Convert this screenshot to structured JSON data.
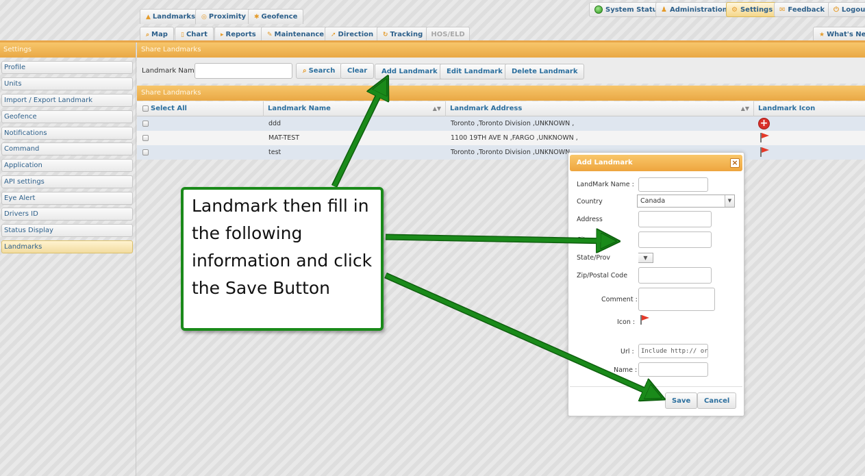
{
  "nav": {
    "row1": [
      {
        "label": "Landmarks"
      },
      {
        "label": "Proximity"
      },
      {
        "label": "Geofence"
      }
    ],
    "row2": [
      {
        "label": "Map"
      },
      {
        "label": "Chart"
      },
      {
        "label": "Reports"
      },
      {
        "label": "Maintenance"
      },
      {
        "label": "Direction"
      },
      {
        "label": "Tracking"
      },
      {
        "label": "HOS/ELD"
      }
    ],
    "right": [
      {
        "label": "System Status"
      },
      {
        "label": "Administration"
      },
      {
        "label": "Settings"
      },
      {
        "label": "Feedback"
      },
      {
        "label": "Logout"
      }
    ],
    "whats_new": "What's New"
  },
  "sidebar": {
    "title": "Settings",
    "items": [
      {
        "label": "Profile"
      },
      {
        "label": "Units"
      },
      {
        "label": "Import / Export Landmark"
      },
      {
        "label": "Geofence"
      },
      {
        "label": "Notifications"
      },
      {
        "label": "Command"
      },
      {
        "label": "Application"
      },
      {
        "label": "API settings"
      },
      {
        "label": "Eye Alert"
      },
      {
        "label": "Drivers ID"
      },
      {
        "label": "Status Display"
      },
      {
        "label": "Landmarks"
      }
    ],
    "active_index": 11
  },
  "main": {
    "section_title": "Share Landmarks",
    "grid_title": "Share Landmarks",
    "toolbar": {
      "name_label": "Landmark Name:",
      "name_value": "",
      "search": "Search",
      "clear": "Clear",
      "add": "Add Landmark",
      "edit": "Edit Landmark",
      "delete": "Delete Landmark"
    },
    "columns": {
      "select_all": "Select All",
      "name": "Landmark Name",
      "address": "Landmark Address",
      "icon": "Landmark Icon"
    },
    "rows": [
      {
        "name": "ddd",
        "address": "Toronto ,Toronto Division ,UNKNOWN ,",
        "icon": "plus-icon"
      },
      {
        "name": "MAT-TEST",
        "address": "1100 19TH AVE N ,FARGO ,UNKNOWN ,",
        "icon": "red-flag-icon"
      },
      {
        "name": "test",
        "address": "Toronto ,Toronto Division ,UNKNOWN ,",
        "icon": "red-flag-icon"
      }
    ]
  },
  "dialog": {
    "title": "Add Landmark",
    "close": "×",
    "fields": {
      "landmark_name_label": "LandMark Name :",
      "landmark_name_value": "",
      "country_label": "Country",
      "country_value": "Canada",
      "address_label": "Address",
      "address_value": "",
      "city_label": "City",
      "city_value": "",
      "state_label": "State/Prov",
      "state_value": "",
      "zip_label": "Zip/Postal Code",
      "zip_value": "",
      "comment_label": "Comment :",
      "comment_value": "",
      "icon_label": "Icon :",
      "url_label": "Url :",
      "url_placeholder": "Include http:// or https://",
      "name_label": "Name :",
      "name_value": ""
    },
    "save": "Save",
    "cancel": "Cancel"
  },
  "annotation": {
    "text": "Landmark then fill in the following information and click the Save Button",
    "color": "#1a8a1a"
  }
}
